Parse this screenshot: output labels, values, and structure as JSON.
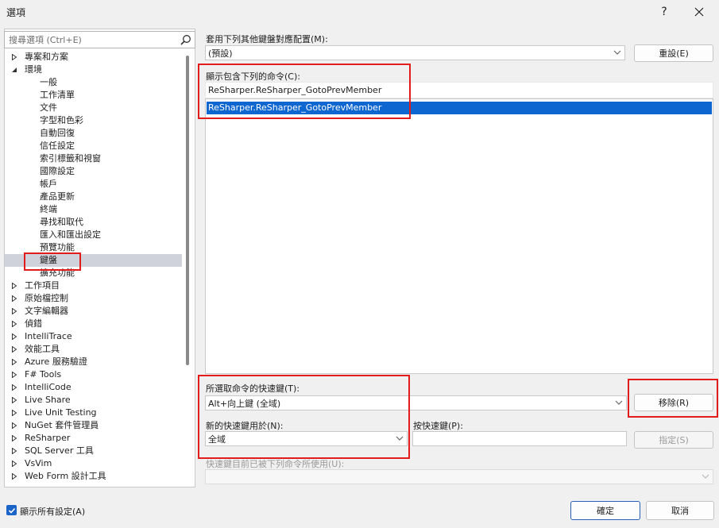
{
  "window": {
    "title": "選項",
    "help_label": "?",
    "close_label": "✕"
  },
  "search": {
    "placeholder": "搜尋選項 (Ctrl+E)"
  },
  "tree": [
    {
      "label": "專案和方案",
      "arrow": "right",
      "indent": 0
    },
    {
      "label": "環境",
      "arrow": "down",
      "indent": 0
    },
    {
      "label": "一般",
      "arrow": "",
      "indent": 1
    },
    {
      "label": "工作清單",
      "arrow": "",
      "indent": 1
    },
    {
      "label": "文件",
      "arrow": "",
      "indent": 1
    },
    {
      "label": "字型和色彩",
      "arrow": "",
      "indent": 1
    },
    {
      "label": "自動回復",
      "arrow": "",
      "indent": 1
    },
    {
      "label": "信任設定",
      "arrow": "",
      "indent": 1
    },
    {
      "label": "索引標籤和視窗",
      "arrow": "",
      "indent": 1
    },
    {
      "label": "國際設定",
      "arrow": "",
      "indent": 1
    },
    {
      "label": "帳戶",
      "arrow": "",
      "indent": 1
    },
    {
      "label": "產品更新",
      "arrow": "",
      "indent": 1
    },
    {
      "label": "終端",
      "arrow": "",
      "indent": 1
    },
    {
      "label": "尋找和取代",
      "arrow": "",
      "indent": 1
    },
    {
      "label": "匯入和匯出設定",
      "arrow": "",
      "indent": 1
    },
    {
      "label": "預覽功能",
      "arrow": "",
      "indent": 1
    },
    {
      "label": "鍵盤",
      "arrow": "",
      "indent": 1,
      "selected": true
    },
    {
      "label": "擴充功能",
      "arrow": "",
      "indent": 1
    },
    {
      "label": "工作項目",
      "arrow": "right",
      "indent": 0
    },
    {
      "label": "原始檔控制",
      "arrow": "right",
      "indent": 0
    },
    {
      "label": "文字編輯器",
      "arrow": "right",
      "indent": 0
    },
    {
      "label": "偵錯",
      "arrow": "right",
      "indent": 0
    },
    {
      "label": "IntelliTrace",
      "arrow": "right",
      "indent": 0
    },
    {
      "label": "效能工具",
      "arrow": "right",
      "indent": 0
    },
    {
      "label": "Azure 服務驗證",
      "arrow": "right",
      "indent": 0
    },
    {
      "label": "F# Tools",
      "arrow": "right",
      "indent": 0
    },
    {
      "label": "IntelliCode",
      "arrow": "right",
      "indent": 0
    },
    {
      "label": "Live Share",
      "arrow": "right",
      "indent": 0
    },
    {
      "label": "Live Unit Testing",
      "arrow": "right",
      "indent": 0
    },
    {
      "label": "NuGet 套件管理員",
      "arrow": "right",
      "indent": 0
    },
    {
      "label": "ReSharper",
      "arrow": "right",
      "indent": 0
    },
    {
      "label": "SQL Server 工具",
      "arrow": "right",
      "indent": 0
    },
    {
      "label": "VsVim",
      "arrow": "right",
      "indent": 0
    },
    {
      "label": "Web Form 設計工具",
      "arrow": "right",
      "indent": 0
    }
  ],
  "keyboard": {
    "mapping_label": "套用下列其他鍵盤對應配置(M):",
    "mapping_value": "(預設)",
    "reset_button": "重設(E)",
    "commands_label": "顯示包含下列的命令(C):",
    "commands_filter": "ReSharper.ReSharper_GotoPrevMember",
    "commands_list": [
      "ReSharper.ReSharper_GotoPrevMember"
    ],
    "shortcuts_label": "所選取命令的快速鍵(T):",
    "shortcuts_value": "Alt+向上鍵 (全域)",
    "remove_button": "移除(R)",
    "use_in_label": "新的快速鍵用於(N):",
    "use_in_value": "全域",
    "press_keys_label": "按快速鍵(P):",
    "press_keys_value": "",
    "assign_button": "指定(S)",
    "used_by_label": "快速鍵目前已被下列命令所使用(U):",
    "used_by_value": ""
  },
  "footer": {
    "show_all_label": "顯示所有設定(A)",
    "show_all_checked": true,
    "ok_button": "確定",
    "cancel_button": "取消"
  },
  "colors": {
    "selection": "#0e66d0",
    "highlight_box": "#e21b1b",
    "tree_selected": "#cfd2da"
  }
}
